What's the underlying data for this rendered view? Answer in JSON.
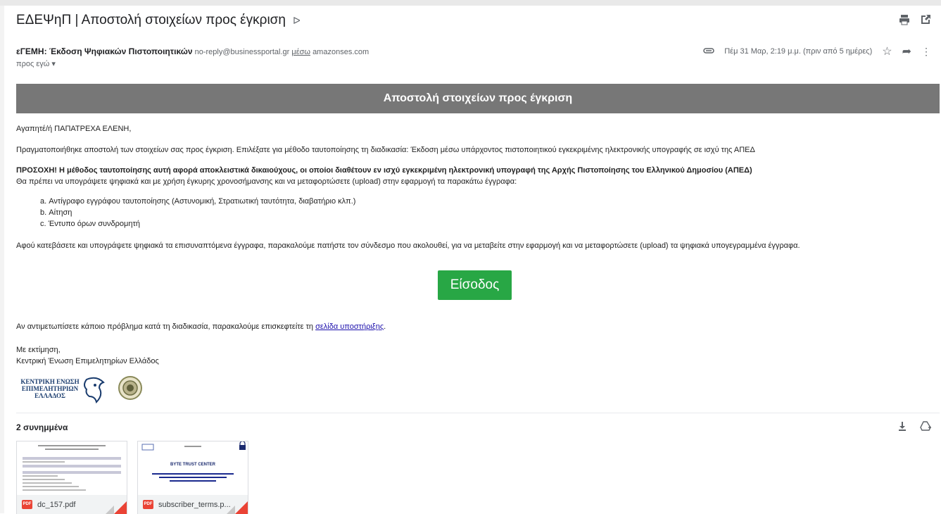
{
  "email": {
    "subject": "ΕΔΕΨηΠ | Αποστολή στοιχείων προς έγκριση",
    "sender_name": "εΓΕΜΗ: Έκδοση Ψηφιακών Πιστοποιητικών",
    "sender_email": "no-reply@businessportal.gr",
    "via_label": "μέσω",
    "via_domain": "amazonses.com",
    "to_label": "προς εγώ ▾",
    "date": "Πέμ 31 Μαρ, 2:19 μ.μ. (πριν από 5 ημέρες)"
  },
  "content": {
    "banner": "Αποστολή στοιχείων προς έγκριση",
    "greeting": "Αγαπητέ/ή ΠΑΠΑΤΡΕΧΑ ΕΛΕΝΗ,",
    "para1": "Πραγματοποιήθηκε αποστολή των στοιχείων σας προς έγκριση. Επιλέξατε για μέθοδο ταυτοποίησης τη διαδικασία: Έκδοση μέσω υπάρχοντος πιστοποιητικού εγκεκριμένης ηλεκτρονικής υπογραφής σε ισχύ της ΑΠΕΔ",
    "warning": "ΠΡΟΣΟΧΗ! Η μέθοδος ταυτοποίησης αυτή αφορά αποκλειστικά δικαιούχους, οι οποίοι διαθέτουν εν ισχύ εγκεκριμένη ηλεκτρονική υπογραφή της Αρχής Πιστοποίησης του Ελληνικού Δημοσίου (ΑΠΕΔ)",
    "para2": "Θα πρέπει να υπογράψετε ψηφιακά και με χρήση έγκυρης χρονοσήμανσης και να μεταφορτώσετε (upload) στην εφαρμογή τα παρακάτω έγγραφα:",
    "list": [
      "a. Αντίγραφο εγγράφου ταυτοποίησης (Αστυνομική, Στρατιωτική ταυτότητα, διαβατήριο κλπ.)",
      "b. Αίτηση",
      "c. Έντυπο όρων συνδρομητή"
    ],
    "para3": "Αφού κατεβάσετε και υπογράψετε ψηφιακά τα επισυναπτόμενα έγγραφα, παρακαλούμε πατήστε τον σύνδεσμο που ακολουθεί, για να μεταβείτε στην εφαρμογή και να μεταφορτώσετε (upload) τα ψηφιακά υπογεγραμμένα έγγραφα.",
    "button": "Είσοδος",
    "support_text": "Αν αντιμετωπίσετε κάποιο πρόβλημα κατά τη διαδικασία, παρακαλούμε επισκεφτείτε τη",
    "support_link": "σελίδα υποστήριξης",
    "regards": "Με εκτίμηση,",
    "org": "Κεντρική Ένωση Επιμελητηρίων Ελλάδος",
    "logo_lines": [
      "ΚΕΝΤΡΙΚΗ ΕΝΩΣΗ",
      "ΕΠΙΜΕΛΗΤΗΡΙΩΝ",
      "ΕΛΛΑΔΟΣ"
    ]
  },
  "attachments": {
    "count_label": "2 συνημμένα",
    "files": [
      {
        "name": "dc_157.pdf",
        "badge": "PDF"
      },
      {
        "name": "subscriber_terms.p...",
        "badge": "PDF",
        "doc_title": "BYTE TRUST CENTER"
      }
    ]
  },
  "colors": {
    "banner": "#777777",
    "button": "#28a745",
    "link": "#1a0dab",
    "pdf": "#ea4335"
  }
}
